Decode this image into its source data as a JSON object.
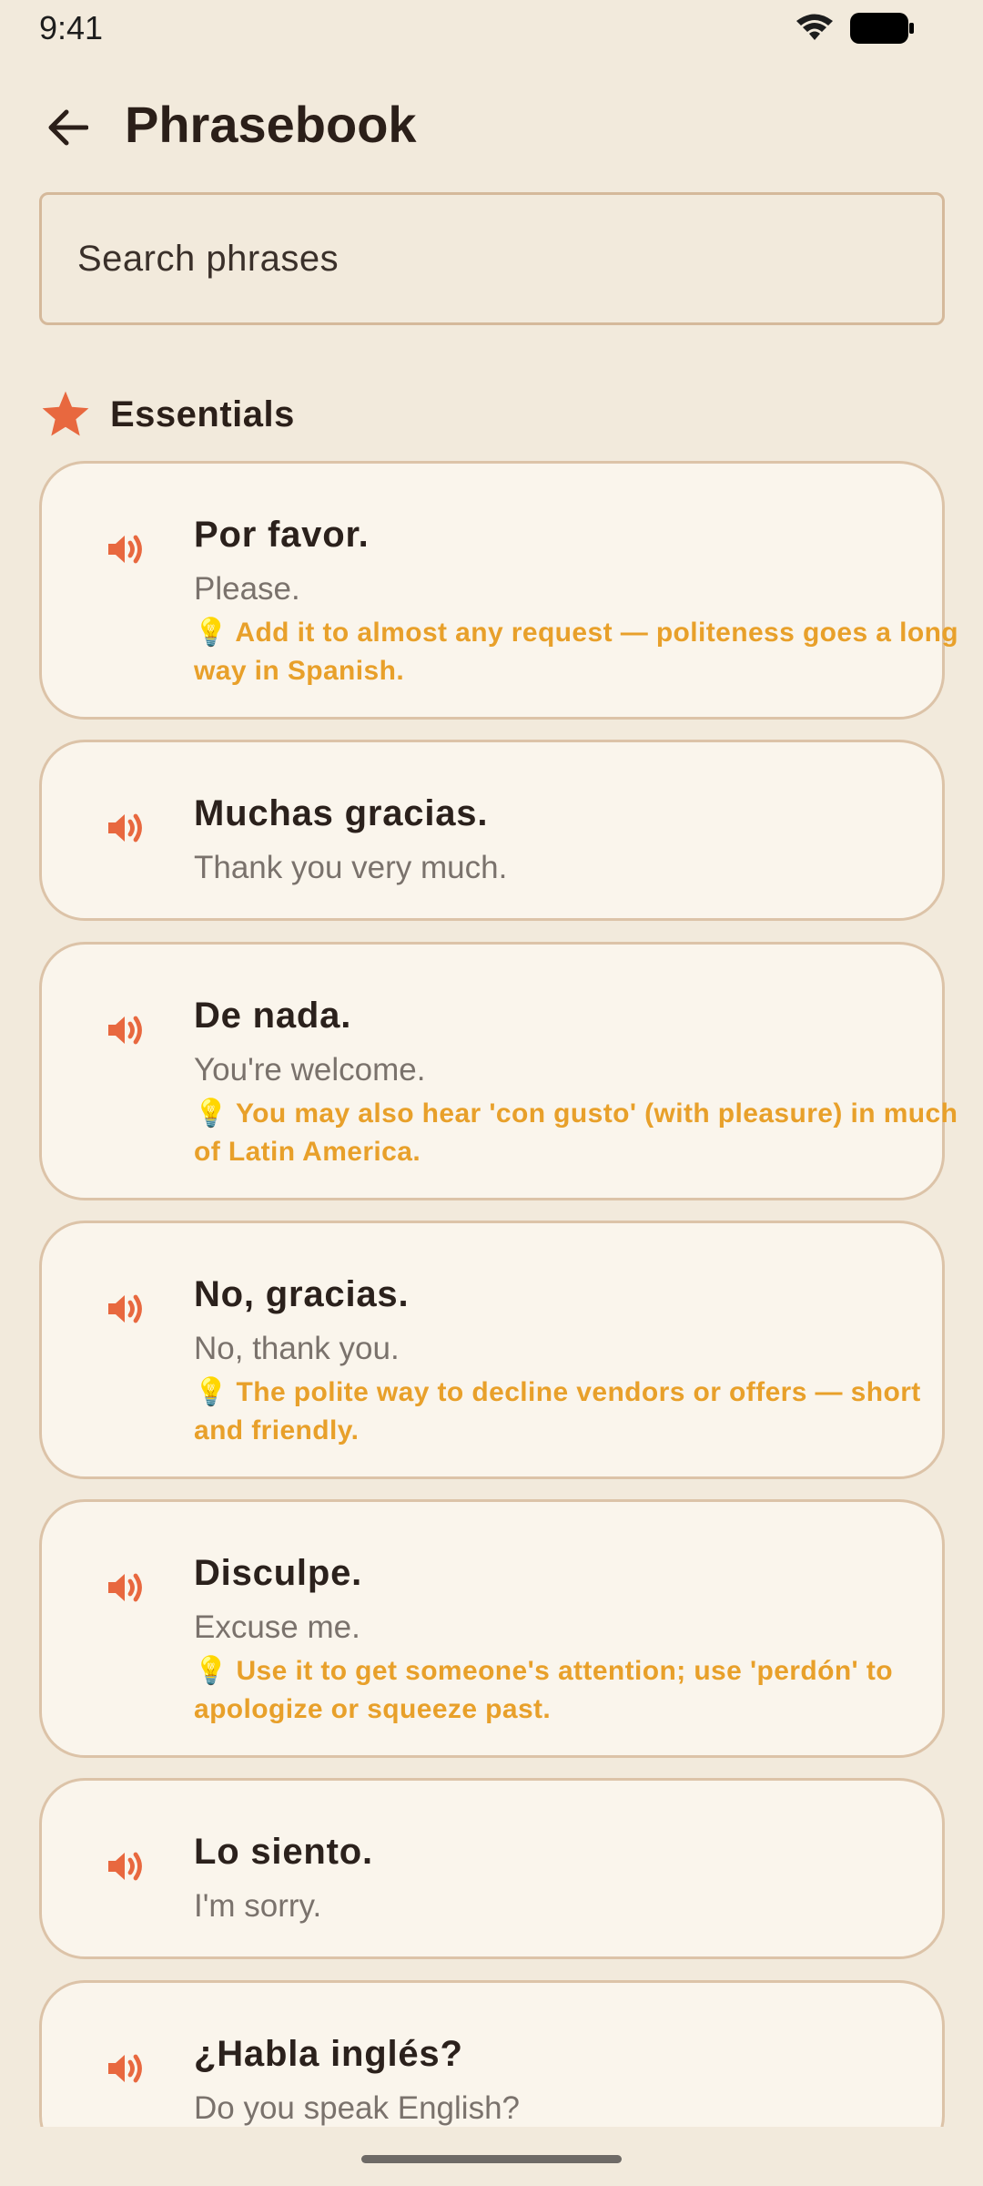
{
  "status_bar": {
    "time": "9:41"
  },
  "app_bar": {
    "title": "Phrasebook",
    "back_icon": "arrow-left-icon"
  },
  "search": {
    "placeholder": "Search phrases"
  },
  "section": {
    "title": "Essentials",
    "icon": "star-icon"
  },
  "colors": {
    "background": "#F2EADC",
    "card": "#FAF5EC",
    "card_border": "#DCC3A8",
    "accent": "#E8683F",
    "tip": "#E8A02A"
  },
  "phrases": [
    {
      "phrase": "Por favor.",
      "translation": "Please.",
      "tip": "💡 Add it to almost any request — politeness goes a long way in Spanish."
    },
    {
      "phrase": "Muchas gracias.",
      "translation": "Thank you very much."
    },
    {
      "phrase": "De nada.",
      "translation": "You're welcome.",
      "tip": "💡 You may also hear 'con gusto' (with pleasure) in much of Latin America."
    },
    {
      "phrase": "No, gracias.",
      "translation": "No, thank you.",
      "tip": "💡 The polite way to decline vendors or offers — short and friendly."
    },
    {
      "phrase": "Disculpe.",
      "translation": "Excuse me.",
      "tip": "💡 Use it to get someone's attention; use 'perdón' to apologize or squeeze past."
    },
    {
      "phrase": "Lo siento.",
      "translation": "I'm sorry."
    },
    {
      "phrase": "¿Habla inglés?",
      "translation": "Do you speak English?"
    }
  ]
}
